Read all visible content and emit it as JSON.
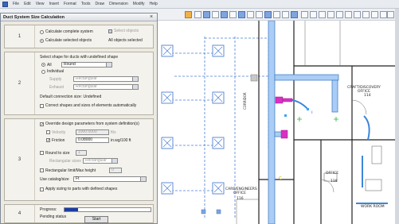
{
  "app": {
    "menus": [
      "File",
      "Edit",
      "View",
      "Insert",
      "Format",
      "Tools",
      "Draw",
      "Dimension",
      "Modify",
      "Help"
    ]
  },
  "dialog": {
    "title": "Duct System Size Calculation",
    "close_glyph": "×",
    "step1": {
      "number": "1",
      "options": [
        {
          "label": "Calculate complete system",
          "selected": false
        },
        {
          "label": "Calculate selected objects",
          "selected": true
        }
      ],
      "select_objects_label": "Select objects",
      "all_selected_label": "All objects selected"
    },
    "step2": {
      "number": "2",
      "heading": "Select shape for ducts with undefined shape",
      "options": [
        {
          "label": "All",
          "selected": true
        },
        {
          "label": "Individual",
          "selected": false
        }
      ],
      "all_value": "Round",
      "individual_rows": [
        {
          "label": "Supply",
          "value": "Rectangular"
        },
        {
          "label": "Exhaust",
          "value": "Rectangular"
        }
      ],
      "default_text": "Default connection size: Undefined",
      "check_label": "Correct shapes and sizes of elements automatically"
    },
    "step3": {
      "number": "3",
      "heading": "Override design parameters from system definition(s)",
      "velocity": {
        "label": "Velocity",
        "value": "1000.0000",
        "unit": "ft/s",
        "checked": false
      },
      "friction": {
        "label": "Friction",
        "value": "0.08000",
        "unit": "in.wg/100 ft",
        "checked": true
      },
      "round_to_size": {
        "label": "Round to size",
        "value": "1\"",
        "checked": false
      },
      "rect_sizes": {
        "label": "Rectangular sizes",
        "value": "Rectangular",
        "muted": true
      },
      "max_width": {
        "label": "Rectangular limit/Max height",
        "value": "0\""
      },
      "use_catalog": {
        "label": "Use catalog/size",
        "value": "Ft"
      },
      "apply_label": "Apply sizing to parts with defined shapes"
    },
    "step4": {
      "number": "4",
      "progress_label": "Progress:",
      "progress": 0.16,
      "status_label": "Pending status",
      "button_label": "Start"
    }
  },
  "drawing": {
    "labels": [
      "CRAFT/DISCOVERY OFFICE",
      "CARE/ENGINEERS OFFICE",
      "OFFICE",
      "WORK ROOM",
      "CORRIDOR"
    ],
    "room_numbers": [
      "114",
      "116",
      "118"
    ]
  }
}
